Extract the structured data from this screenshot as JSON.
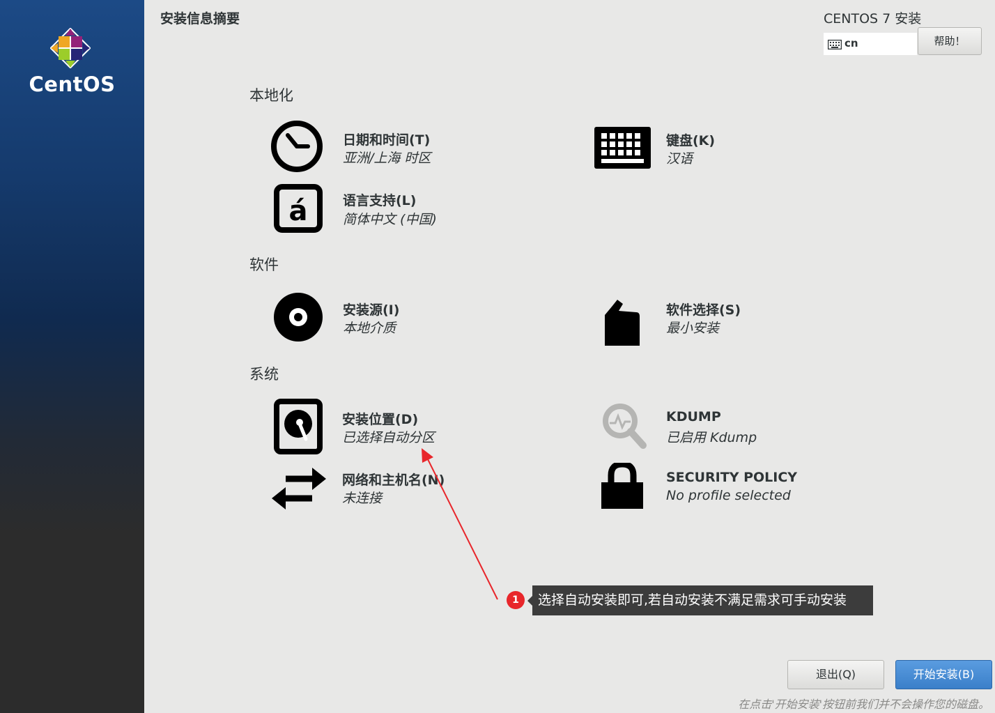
{
  "sidebar": {
    "logo_text": "CentOS"
  },
  "header": {
    "hub_title": "安装信息摘要",
    "product_title": "CENTOS 7 安装",
    "keyboard_layout": "cn",
    "help_label": "帮助！"
  },
  "categories": {
    "localization": "本地化",
    "software": "软件",
    "system": "系统"
  },
  "spokes": {
    "datetime": {
      "title": "日期和时间(T)",
      "status": "亚洲/上海 时区",
      "icon": "clock-icon"
    },
    "keyboard": {
      "title": "键盘(K)",
      "status": "汉语",
      "icon": "keyboard-icon"
    },
    "language": {
      "title": "语言支持(L)",
      "status": "简体中文 (中国)",
      "icon": "language-icon"
    },
    "source": {
      "title": "安装源(I)",
      "status": "本地介质",
      "icon": "disc-icon"
    },
    "software_selection": {
      "title": "软件选择(S)",
      "status": "最小安装",
      "icon": "package-icon"
    },
    "storage": {
      "title": "安装位置(D)",
      "status": "已选择自动分区",
      "icon": "harddisk-icon"
    },
    "kdump": {
      "title": "KDUMP",
      "status": "已启用 Kdump",
      "icon": "magnifier-icon"
    },
    "network": {
      "title": "网络和主机名(N)",
      "status": "未连接",
      "icon": "network-arrows-icon"
    },
    "security": {
      "title": "SECURITY POLICY",
      "status": "No profile selected",
      "icon": "lock-icon"
    }
  },
  "footer": {
    "quit_label": "退出(Q)",
    "begin_label": "开始安装(B)",
    "warning": "在点击'开始安装'按钮前我们并不会操作您的磁盘。"
  },
  "annotation": {
    "number": "1",
    "text": "选择自动安装即可,若自动安装不满足需求可手动安装",
    "color": "#e8262b"
  }
}
